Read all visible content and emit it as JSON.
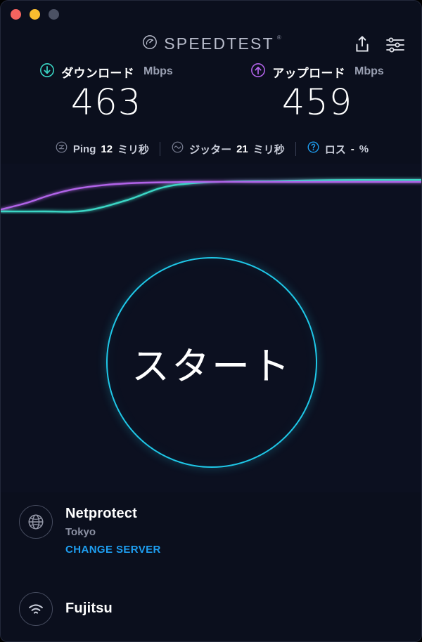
{
  "window": {
    "traffic_lights": [
      {
        "name": "close",
        "color": "#f4645f"
      },
      {
        "name": "minimize",
        "color": "#f9bd2f"
      },
      {
        "name": "zoom",
        "color": "#4b5163"
      }
    ]
  },
  "header": {
    "brand": "SPEEDTEST",
    "brand_registered": "®",
    "gauge_icon": "speedtest-gauge-icon",
    "share_icon": "share-icon",
    "settings_icon": "settings-sliders-icon"
  },
  "metrics": [
    {
      "icon": "download-arrow-icon",
      "icon_color": "#3ad6c5",
      "label": "ダウンロード",
      "unit": "Mbps",
      "value": "463"
    },
    {
      "icon": "upload-arrow-icon",
      "icon_color": "#b163e8",
      "label": "アップロード",
      "unit": "Mbps",
      "value": "459"
    }
  ],
  "stats": [
    {
      "icon": "ping-icon",
      "icon_color": "#6b7punk",
      "name": "Ping",
      "value": "12",
      "unit": "ミリ秒"
    },
    {
      "icon": "jitter-icon",
      "icon_color": "#7b8094",
      "name": "ジッター",
      "value": "21",
      "unit": "ミリ秒"
    },
    {
      "icon": "loss-help-icon",
      "icon_color": "#1e9ff2",
      "name": "ロス",
      "value": "-",
      "unit": "%"
    }
  ],
  "start_button": {
    "label": "スタート",
    "accent": "#1fc8e8"
  },
  "server": {
    "icon": "globe-icon",
    "name": "Netprotect",
    "location": "Tokyo",
    "change_label": "CHANGE SERVER",
    "change_color": "#1e9ff2"
  },
  "connection": {
    "icon": "wifi-icon",
    "name": "Fujitsu"
  },
  "chart_data": {
    "type": "line",
    "title": "",
    "xlabel": "",
    "ylabel": "",
    "grid": false,
    "legend": "none",
    "series": [
      {
        "name": "ダウンロード",
        "color": "#3ad6c5",
        "points": [
          [
            0,
            0.0
          ],
          [
            10,
            0.0
          ],
          [
            20,
            0.02
          ],
          [
            30,
            0.3
          ],
          [
            38,
            0.62
          ],
          [
            45,
            0.74
          ],
          [
            55,
            0.79
          ],
          [
            65,
            0.8
          ],
          [
            75,
            0.82
          ],
          [
            85,
            0.83
          ],
          [
            100,
            0.83
          ]
        ]
      },
      {
        "name": "アップロード",
        "color": "#b163e8",
        "points": [
          [
            0,
            0.05
          ],
          [
            6,
            0.22
          ],
          [
            12,
            0.44
          ],
          [
            18,
            0.6
          ],
          [
            25,
            0.7
          ],
          [
            32,
            0.75
          ],
          [
            40,
            0.77
          ],
          [
            50,
            0.78
          ],
          [
            60,
            0.78
          ],
          [
            70,
            0.78
          ],
          [
            85,
            0.78
          ],
          [
            100,
            0.78
          ]
        ]
      }
    ]
  }
}
